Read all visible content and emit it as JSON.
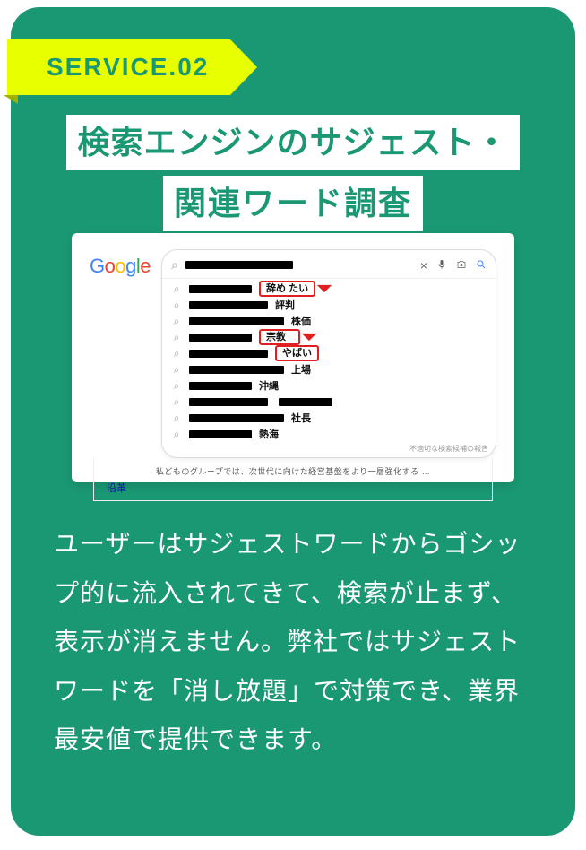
{
  "ribbon": {
    "label": "SERVICE.02"
  },
  "heading": {
    "line1": "検索エンジンのサジェスト・",
    "line2": "関連ワード調査"
  },
  "illustration": {
    "logo_letters": [
      "G",
      "o",
      "o",
      "g",
      "l",
      "e"
    ],
    "icons": {
      "close": "×",
      "mic": "🎤",
      "camera": "📷",
      "search": "🔍"
    },
    "suggestions": [
      {
        "word": "辞め たい",
        "highlighted": true,
        "pointer": true
      },
      {
        "word": "評判",
        "highlighted": false
      },
      {
        "word": "株価",
        "highlighted": false
      },
      {
        "word": "宗教",
        "highlighted": true,
        "pointer": true
      },
      {
        "word": "やばい",
        "highlighted": true
      },
      {
        "word": "上場",
        "highlighted": false
      },
      {
        "word": "沖縄",
        "highlighted": false
      },
      {
        "word": "",
        "highlighted": false,
        "double_bar": true
      },
      {
        "word": "社長",
        "highlighted": false
      },
      {
        "word": "熱海",
        "highlighted": false
      }
    ],
    "footnote": "不適切な検索候補の報告",
    "result_hint": "私どものグループでは、次世代に向けた経営基盤をより一層強化する …",
    "link": "沿革"
  },
  "body": "ユーザーはサジェストワードからゴシップ的に流入されてきて、検索が止まず、表示が消えません。弊社ではサジェストワードを「消し放題」で対策でき、業界最安値で提供できます。"
}
